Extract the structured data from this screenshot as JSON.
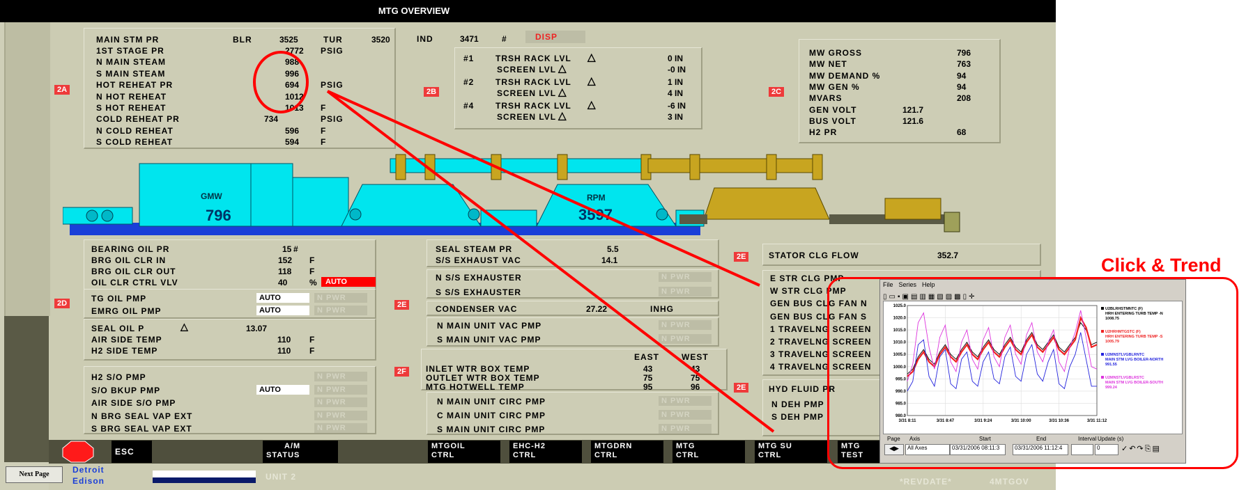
{
  "title": "MTG OVERVIEW",
  "disp_button": "DISP",
  "section_tags": {
    "a": "2A",
    "b": "2B",
    "c": "2C",
    "d": "2D",
    "e1": "2E",
    "e2": "2E",
    "e3": "2E",
    "f": "2F"
  },
  "steam": {
    "main_stm_pr": {
      "label": "MAIN STM PR",
      "blr_label": "BLR",
      "blr": "3525",
      "tur_label": "TUR",
      "tur": "3520",
      "ind_label": "IND",
      "ind": "3471",
      "unit": "#"
    },
    "rows": [
      {
        "label": "1ST STAGE PR",
        "value": "2772",
        "unit": "PSIG"
      },
      {
        "label": "N MAIN STEAM",
        "value": "988",
        "unit": ""
      },
      {
        "label": "S MAIN STEAM",
        "value": "996",
        "unit": ""
      },
      {
        "label": "HOT REHEAT PR",
        "value": "694",
        "unit": "PSIG"
      },
      {
        "label": "N HOT REHEAT",
        "value": "1012",
        "unit": ""
      },
      {
        "label": "S HOT REHEAT",
        "value": "1013",
        "unit": "F"
      },
      {
        "label": "COLD REHEAT PR",
        "value": "734",
        "unit": "PSIG"
      },
      {
        "label": "N COLD REHEAT",
        "value": "596",
        "unit": "F"
      },
      {
        "label": "S COLD REHEAT",
        "value": "594",
        "unit": "F"
      }
    ]
  },
  "trash_rack": [
    {
      "num": "#1",
      "label": "TRSH RACK LVL",
      "value": "0 IN",
      "screen_label": "SCREEN LVL",
      "screen_value": "-0 IN"
    },
    {
      "num": "#2",
      "label": "TRSH RACK LVL",
      "value": "1 IN",
      "screen_label": "SCREEN LVL",
      "screen_value": "4 IN"
    },
    {
      "num": "#4",
      "label": "TRSH RACK LVL",
      "value": "-6 IN",
      "screen_label": "SCREEN LVL",
      "screen_value": "3 IN"
    }
  ],
  "generator": [
    {
      "label": "MW GROSS",
      "value": "796"
    },
    {
      "label": "MW NET",
      "value": "763"
    },
    {
      "label": "MW DEMAND %",
      "value": "94"
    },
    {
      "label": "MW GEN %",
      "value": "94"
    },
    {
      "label": "MVARS",
      "value": "208"
    },
    {
      "label": "GEN VOLT",
      "value": "121.7"
    },
    {
      "label": "BUS VOLT",
      "value": "121.6"
    },
    {
      "label": "H2 PR",
      "value": "68"
    }
  ],
  "turbine": {
    "gmw_label": "GMW",
    "gmw": "796",
    "rpm_label": "RPM",
    "rpm": "3597"
  },
  "oil": {
    "rows": [
      {
        "label": "BEARING OIL PR",
        "value": "15",
        "unit": "#"
      },
      {
        "label": "BRG OIL CLR IN",
        "value": "152",
        "unit": "F"
      },
      {
        "label": "BRG OIL CLR OUT",
        "value": "118",
        "unit": "F"
      },
      {
        "label": "OIL CLR CTRL VLV",
        "value": "40",
        "unit": "%",
        "state": "AUTO"
      }
    ],
    "pumps": [
      {
        "label": "TG OIL PMP",
        "mode": "AUTO",
        "status": "N PWR"
      },
      {
        "label": "EMRG OIL PMP",
        "mode": "AUTO",
        "status": "N PWR"
      }
    ],
    "seal": {
      "label": "SEAL OIL P",
      "value": "13.07",
      "air_label": "AIR SIDE TEMP",
      "air": "110",
      "h2_label": "H2 SIDE TEMP",
      "h2": "110",
      "unit": "F"
    },
    "so": [
      {
        "label": "H2 S/O PMP",
        "mode": "",
        "status": "N PWR"
      },
      {
        "label": "S/O BKUP PMP",
        "mode": "AUTO",
        "status": "N PWR"
      },
      {
        "label": "AIR SIDE S/O PMP",
        "mode": "",
        "status": "N PWR"
      },
      {
        "label": "N BRG SEAL VAP EXT",
        "mode": "",
        "status": "N PWR"
      },
      {
        "label": "S BRG SEAL VAP EXT",
        "mode": "",
        "status": "N PWR"
      }
    ]
  },
  "condenser": {
    "seal_steam_label": "SEAL STEAM PR",
    "seal_steam": "5.5",
    "exhaust_vac_label": "S/S EXHAUST VAC",
    "exhaust_vac": "14.1",
    "exhausters": [
      {
        "label": "N S/S EXHAUSTER",
        "status": "N PWR"
      },
      {
        "label": "S S/S EXHAUSTER",
        "status": "N PWR"
      }
    ],
    "cond_vac_label": "CONDENSER VAC",
    "cond_vac": "27.22",
    "cond_vac_unit": "INHG",
    "vac_pmps": [
      {
        "label": "N MAIN UNIT VAC PMP",
        "status": "N PWR"
      },
      {
        "label": "S MAIN UNIT VAC PMP",
        "status": "N PWR"
      }
    ],
    "east_label": "EAST",
    "west_label": "WEST",
    "temps": [
      {
        "label": "INLET WTR BOX TEMP",
        "east": "43",
        "west": "43"
      },
      {
        "label": "OUTLET WTR BOX TEMP",
        "east": "75",
        "west": "75"
      },
      {
        "label": "MTG HOTWELL TEMP",
        "east": "95",
        "west": "96"
      }
    ],
    "circ_pmps": [
      {
        "label": "N MAIN UNIT CIRC PMP",
        "status": "N PWR"
      },
      {
        "label": "C MAIN UNIT CIRC PMP",
        "status": "N PWR"
      },
      {
        "label": "S MAIN UNIT CIRC PMP",
        "status": "N PWR"
      }
    ]
  },
  "stator": {
    "label": "STATOR CLG FLOW",
    "value": "352.7"
  },
  "cooling": [
    "E STR CLG PMP",
    "W STR CLG PMP",
    "GEN BUS CLG FAN N",
    "GEN BUS CLG FAN S",
    "1 TRAVELNG SCREEN",
    "2 TRAVELNG SCREEN",
    "3 TRAVELNG SCREEN",
    "4 TRAVELNG SCREEN"
  ],
  "hyd": {
    "label": "HYD FLUID PR",
    "rows": [
      "N DEH PMP",
      "S DEH PMP"
    ]
  },
  "bottom": {
    "esc": "ESC",
    "buttons": [
      {
        "l1": "A/M",
        "l2": "STATUS"
      },
      {
        "l1": "MTGOIL",
        "l2": "CTRL"
      },
      {
        "l1": "EHC-H2",
        "l2": "CTRL"
      },
      {
        "l1": "MTGDRN",
        "l2": "CTRL"
      },
      {
        "l1": "MTG",
        "l2": "CTRL"
      },
      {
        "l1": "MTG SU",
        "l2": "CTRL"
      },
      {
        "l1": "MTG",
        "l2": "TEST"
      }
    ],
    "next_page": "Next Page",
    "company1": "Detroit",
    "company2": "Edison",
    "unit": "UNIT 2",
    "revdate": "*REVDATE*",
    "page_id": "4MTGOV"
  },
  "callout_title": "Click & Trend",
  "trend": {
    "menu": [
      "File",
      "Series",
      "Help"
    ],
    "legend": [
      {
        "tag": "U2BLRHSTMNTC (F)",
        "desc": "HRH ENTERING TURB TEMP -N",
        "value": "1008.75",
        "color": "#000000"
      },
      {
        "tag": "U2HRHMTGSTC (F)",
        "desc": "HRH ENTERING TURB TEMP -S",
        "value": "1005.79",
        "color": "#ee2222"
      },
      {
        "tag": "U2MNSTLVGBLRNTC",
        "desc": "MAIN STM LVG BOILER-NORTH",
        "value": "991.55",
        "color": "#2222dd"
      },
      {
        "tag": "U2MNSTLVGBLRSTC",
        "desc": "MAIN STM LVG BOILER-SOUTH",
        "value": "999.24",
        "color": "#dd33dd"
      }
    ],
    "footer_labels": {
      "page": "Page",
      "axis": "Axis",
      "start": "Start",
      "end": "End",
      "interval": "Interval",
      "update": "Update (s)"
    },
    "axis_value": "All Axes",
    "start_value": "03/31/2006 08:11:3",
    "end_value": "03/31/2006 11:12:4",
    "update_value": "0"
  },
  "chart_data": {
    "type": "line",
    "x_ticks": [
      "3/31 8:11",
      "3/31 8:47",
      "3/31 9:24",
      "3/31 10:00",
      "3/31 10:36",
      "3/31 11:12"
    ],
    "ylim": [
      980,
      1025
    ],
    "y_ticks": [
      "1025.0",
      "1020.0",
      "1015.0",
      "1010.0",
      "1005.0",
      "1000.0",
      "995.0",
      "990.0",
      "985.0",
      "980.0"
    ],
    "series": [
      {
        "name": "U2BLRHSTMNTC (F)",
        "color": "#000000",
        "values": [
          997,
          999,
          1004,
          1007,
          1003,
          1001,
          1006,
          1009,
          1005,
          1003,
          1007,
          1010,
          1006,
          1004,
          1008,
          1011,
          1007,
          1005,
          1009,
          1012,
          1008,
          1006,
          1011,
          1014,
          1009,
          1007,
          1010,
          1013,
          1008,
          1006,
          1009,
          1012,
          1018,
          1015,
          1009,
          1010
        ]
      },
      {
        "name": "U2HRHMTGSTC (F)",
        "color": "#ee2222",
        "values": [
          996,
          998,
          1003,
          1006,
          1002,
          1000,
          1005,
          1008,
          1004,
          1002,
          1006,
          1009,
          1005,
          1003,
          1007,
          1010,
          1006,
          1004,
          1008,
          1011,
          1007,
          1005,
          1010,
          1013,
          1008,
          1006,
          1009,
          1012,
          1007,
          1005,
          1008,
          1011,
          1020,
          1016,
          1008,
          1009
        ]
      },
      {
        "name": "U2MNSTLVGBLRNTC",
        "color": "#2222dd",
        "values": [
          990,
          994,
          1009,
          1011,
          996,
          992,
          1004,
          1007,
          993,
          991,
          1003,
          1006,
          994,
          992,
          1002,
          1006,
          995,
          993,
          1004,
          1008,
          996,
          994,
          1005,
          1009,
          997,
          994,
          1002,
          1007,
          993,
          991,
          1000,
          1005,
          1014,
          1003,
          992,
          992
        ]
      },
      {
        "name": "U2MNSTLVGBLRSTC",
        "color": "#dd33dd",
        "values": [
          994,
          1001,
          1018,
          1022,
          1008,
          999,
          1012,
          1017,
          1002,
          998,
          1010,
          1015,
          1003,
          999,
          1011,
          1016,
          1004,
          1000,
          1012,
          1017,
          1005,
          1001,
          1013,
          1018,
          1006,
          1002,
          1010,
          1015,
          1002,
          998,
          1008,
          1014,
          1023,
          1012,
          1000,
          999
        ]
      }
    ]
  },
  "colors": {
    "screen_bg": "#ccccb3",
    "turbine_cyan": "#00e5ee",
    "generator_gold": "#c8a520",
    "base_blue": "#1a3fd8",
    "alarm_red": "#ff0000",
    "annotation_red": "#ff0000"
  }
}
